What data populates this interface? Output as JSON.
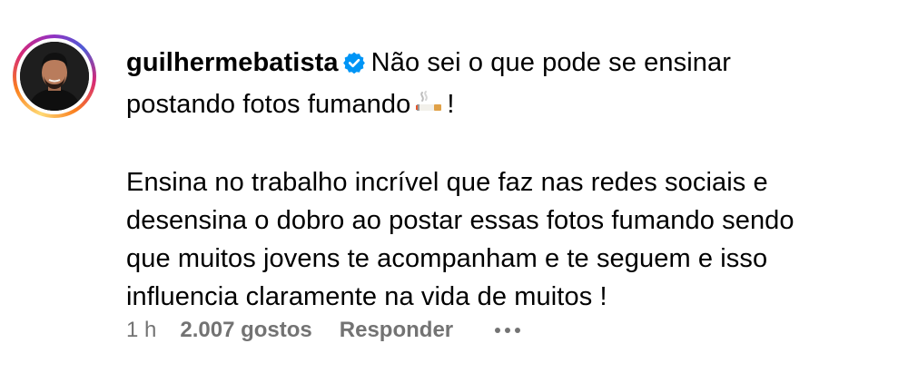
{
  "comment": {
    "username": "guilhermebatista",
    "verified": true,
    "emoji": "smoking-cigarette-emoji",
    "lines": [
      "Não sei o que pode se ensinar",
      "postando fotos fumando",
      "!",
      "Ensina no trabalho incrível que faz nas redes sociais e",
      "desensina o dobro ao postar essas fotos fumando sendo",
      "que muitos jovens te acompanham e te seguem e isso",
      "influencia claramente na vida de muitos !"
    ]
  },
  "meta": {
    "time": "1 h",
    "likes": "2.007 gostos",
    "reply": "Responder"
  },
  "colors": {
    "text": "#000000",
    "meta": "#737373",
    "verified": "#0095f6"
  }
}
